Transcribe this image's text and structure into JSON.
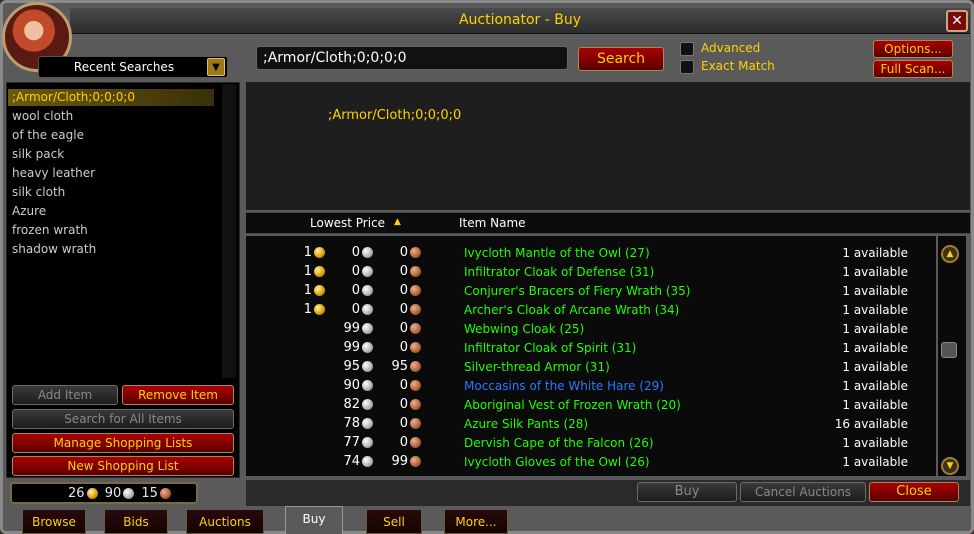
{
  "window": {
    "title": "Auctionator - Buy",
    "close_symbol": "✕"
  },
  "left": {
    "dropdown_label": "Recent Searches",
    "dropdown_arrow": "▼",
    "recent_searches": [
      ";Armor/Cloth;0;0;0;0",
      "wool cloth",
      "of the eagle",
      "silk pack",
      "heavy leather",
      "silk cloth",
      "Azure",
      "frozen wrath",
      "shadow wrath"
    ],
    "selected_index": 0,
    "buttons": {
      "add_item": "Add Item",
      "remove_item": "Remove Item",
      "search_all": "Search for All Items",
      "manage_lists": "Manage Shopping Lists",
      "new_list": "New Shopping List"
    },
    "money": {
      "gold": "26",
      "silver": "90",
      "copper": "15"
    }
  },
  "search": {
    "value": ";Armor/Cloth;0;0;0;0",
    "button": "Search",
    "advanced_label": "Advanced",
    "exact_label": "Exact Match",
    "options_button": "Options...",
    "fullscan_button": "Full Scan..."
  },
  "info": {
    "text": ";Armor/Cloth;0;0;0;0"
  },
  "results": {
    "col_price": "Lowest Price",
    "sort_arrow": "▲",
    "col_name": "Item Name",
    "rows": [
      {
        "g": "1",
        "s": "0",
        "c": "0",
        "name": "Ivycloth Mantle of the Owl (27)",
        "avail": "1 available",
        "color": "green"
      },
      {
        "g": "1",
        "s": "0",
        "c": "0",
        "name": "Infiltrator Cloak of Defense (31)",
        "avail": "1 available",
        "color": "green"
      },
      {
        "g": "1",
        "s": "0",
        "c": "0",
        "name": "Conjurer's Bracers of Fiery Wrath (35)",
        "avail": "1 available",
        "color": "green"
      },
      {
        "g": "1",
        "s": "0",
        "c": "0",
        "name": "Archer's Cloak of Arcane Wrath (34)",
        "avail": "1 available",
        "color": "green"
      },
      {
        "g": "",
        "s": "99",
        "c": "0",
        "name": "Webwing Cloak (25)",
        "avail": "1 available",
        "color": "green"
      },
      {
        "g": "",
        "s": "99",
        "c": "0",
        "name": "Infiltrator Cloak of Spirit (31)",
        "avail": "1 available",
        "color": "green"
      },
      {
        "g": "",
        "s": "95",
        "c": "95",
        "name": "Silver-thread Armor (31)",
        "avail": "1 available",
        "color": "green"
      },
      {
        "g": "",
        "s": "90",
        "c": "0",
        "name": "Moccasins of the White Hare (29)",
        "avail": "1 available",
        "color": "blue"
      },
      {
        "g": "",
        "s": "82",
        "c": "0",
        "name": "Aboriginal Vest of Frozen Wrath (20)",
        "avail": "1 available",
        "color": "green"
      },
      {
        "g": "",
        "s": "78",
        "c": "0",
        "name": "Azure Silk Pants (28)",
        "avail": "16 available",
        "color": "green"
      },
      {
        "g": "",
        "s": "77",
        "c": "0",
        "name": "Dervish Cape of the Falcon (26)",
        "avail": "1 available",
        "color": "green"
      },
      {
        "g": "",
        "s": "74",
        "c": "99",
        "name": "Ivycloth Gloves of the Owl (26)",
        "avail": "1 available",
        "color": "green"
      }
    ]
  },
  "bottom": {
    "buy": "Buy",
    "cancel": "Cancel Auctions",
    "close": "Close"
  },
  "tabs": [
    "Browse",
    "Bids",
    "Auctions",
    "Buy",
    "Sell",
    "More..."
  ],
  "active_tab": "Buy",
  "colors": {
    "gold_text": "#ffd100",
    "uncommon": "#1eff00",
    "rare": "#2a78ff"
  }
}
